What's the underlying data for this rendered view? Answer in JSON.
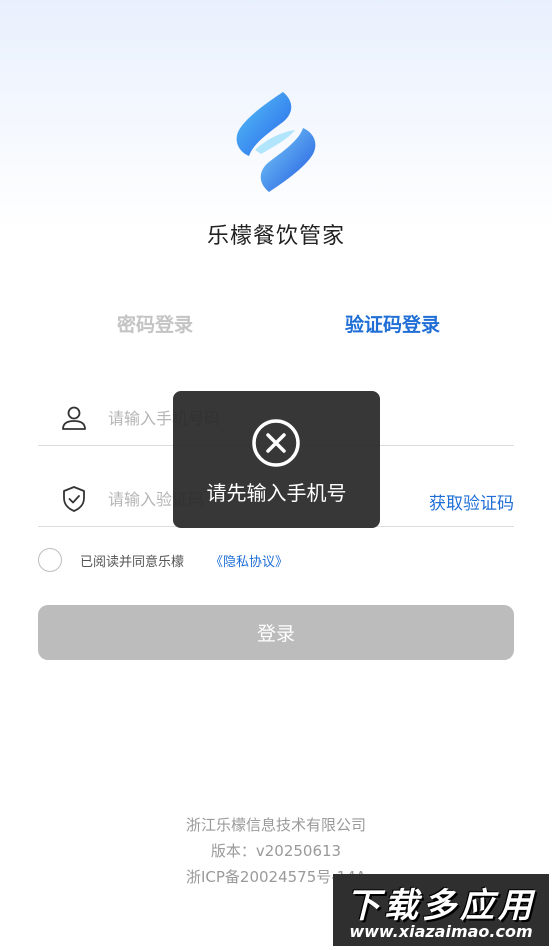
{
  "app": {
    "name": "乐檬餐饮管家"
  },
  "tabs": [
    {
      "label": "密码登录",
      "active": false
    },
    {
      "label": "验证码登录",
      "active": true
    }
  ],
  "form": {
    "phone": {
      "placeholder": "请输入手机号码",
      "value": ""
    },
    "code": {
      "placeholder": "请输入验证码",
      "value": ""
    },
    "get_code_label": "获取验证码",
    "agreement": {
      "text": "已阅读并同意乐檬",
      "link": "《隐私协议》",
      "checked": false
    },
    "login_label": "登录"
  },
  "toast": {
    "message": "请先输入手机号",
    "icon": "close-circle-icon"
  },
  "footer": {
    "company": "浙江乐檬信息技术有限公司",
    "version": "版本：v20250613",
    "icp": "浙ICP备20024575号-14A"
  },
  "watermark": {
    "title": "下载多应用",
    "url": "www.xiazaimao.com"
  },
  "colors": {
    "accent": "#1f6fd6",
    "tab_inactive": "#c4c4c4",
    "button_disabled": "#bcbcbc",
    "toast_bg": "#282828"
  },
  "icons": {
    "logo": "app-logo-icon",
    "phone_field": "user-icon",
    "code_field": "shield-check-icon"
  }
}
